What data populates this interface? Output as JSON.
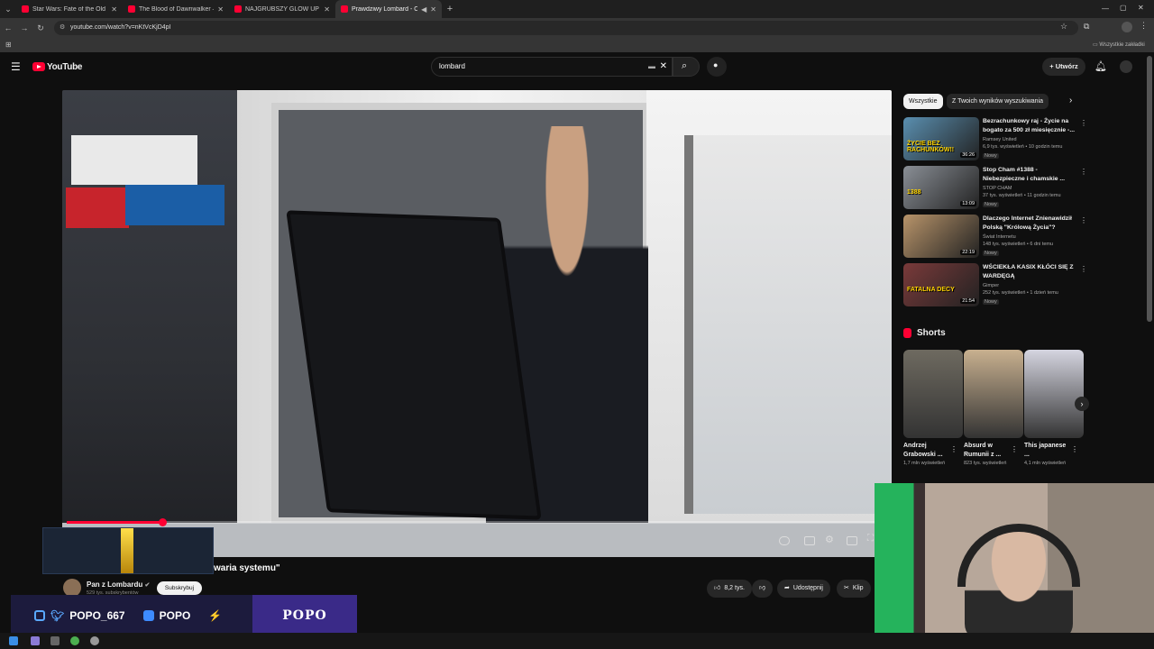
{
  "browser": {
    "tabs": [
      {
        "title": "Star Wars: Fate of the Old Repu",
        "active": false
      },
      {
        "title": "The Blood of Dawnwalker — Pl",
        "active": false
      },
      {
        "title": "NAJGRUBSZY GLOW UP RAFATI",
        "active": false
      },
      {
        "title": "Prawdziwy Lombard - Odc",
        "active": true
      }
    ],
    "url": "youtube.com/watch?v=nKtVcKjD4pI",
    "bookmarks_label": "Wszystkie zakładki"
  },
  "youtube": {
    "logo_text": "YouTube",
    "search_value": "lombard",
    "create_label": "Utwórz"
  },
  "video": {
    "title": "waria systemu\"",
    "progress": 0.116,
    "channel": "Pan z Lombardu",
    "subscribers": "529 tys. subskrybentów",
    "subscribe_label": "Subskrybuj",
    "likes": "8,2 tys.",
    "share_label": "Udostępnij",
    "clip_label": "Klip"
  },
  "filters": [
    "Wszystkie",
    "Z Twoich wyników wyszukiwania"
  ],
  "recommendations": [
    {
      "title": "Bezrachunkowy raj - Życie na bogato za 500 zł miesięcznie -...",
      "channel": "Ramsey United",
      "meta": "6,9 tys. wyświetleń • 10 godzin temu",
      "badge": "Nowy",
      "duration": "36:26",
      "thumb_text": "ŻYCIE BEZ RACHUNKÓW!!",
      "color": "#5a8fb0"
    },
    {
      "title": "Stop Cham #1388 - Niebezpieczne i chamskie ...",
      "channel": "STOP CHAM",
      "meta": "37 tys. wyświetleń • 11 godzin temu",
      "badge": "Nowy",
      "duration": "13:09",
      "thumb_text": "1388",
      "color": "#8a8f96"
    },
    {
      "title": "Dlaczego Internet Znienawidził Polską \"Królową Życia\"?",
      "channel": "Świat Internetu",
      "meta": "148 tys. wyświetleń • 6 dni temu",
      "badge": "Nowy",
      "duration": "22:19",
      "thumb_text": "",
      "color": "#b8946a"
    },
    {
      "title": "WŚCIEKŁA KASIX KŁÓCI SIĘ Z WARDĘGĄ",
      "channel": "Gimper",
      "meta": "252 tys. wyświetleń • 1 dzień temu",
      "badge": "Nowy",
      "duration": "21:54",
      "thumb_text": "FATALNA DECY",
      "color": "#7a3a3a"
    }
  ],
  "shorts": {
    "heading": "Shorts",
    "items": [
      {
        "title": "Andrzej Grabowski ...",
        "views": "1,7 mln wyświetleń",
        "color": "#6e6a60"
      },
      {
        "title": "Absurd w Rumunii z ...",
        "views": "823 tys. wyświetleń",
        "color": "#c8b08f"
      },
      {
        "title": "This japanese ...",
        "views": "4,1 mln wyświetleń",
        "color": "#d5d5e0"
      }
    ]
  },
  "overlay": {
    "social_handle": "POPO_667",
    "yt_handle": "POPO",
    "brand": "POPO"
  }
}
